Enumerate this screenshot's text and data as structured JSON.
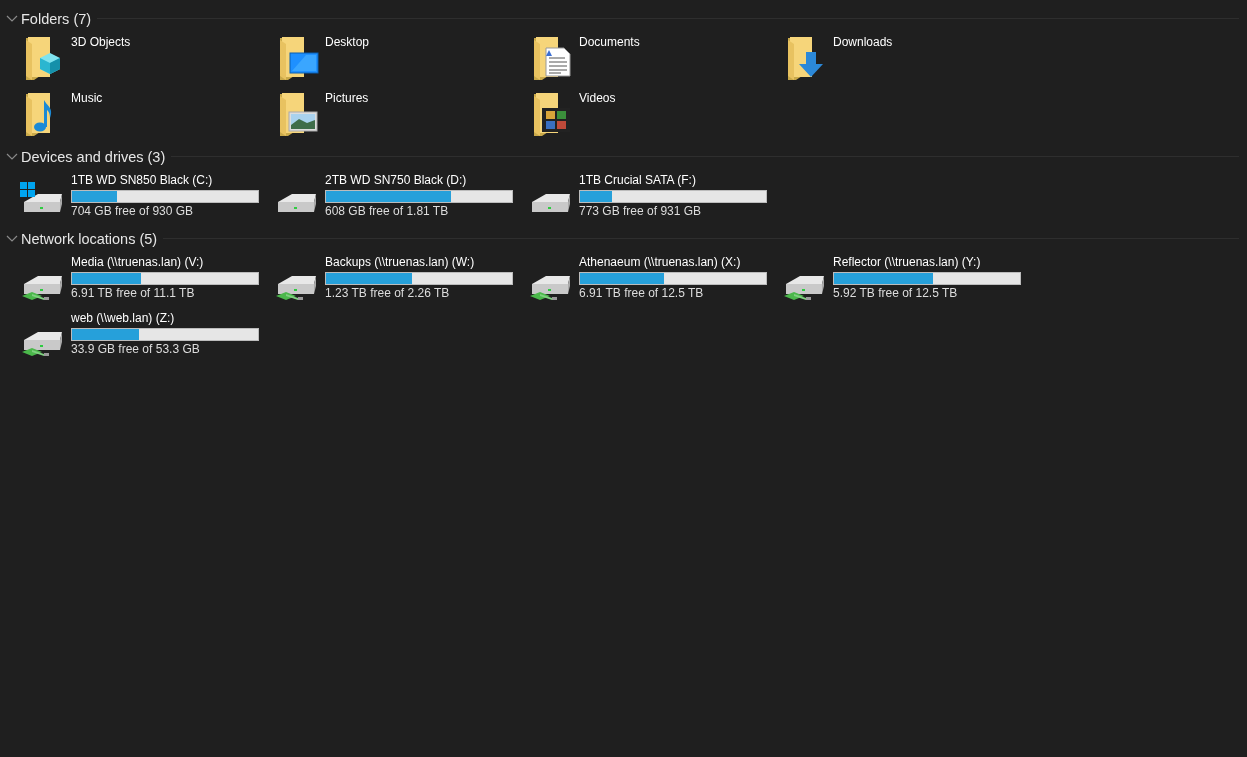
{
  "groups": [
    {
      "kind": "folders",
      "title": "Folders (7)",
      "expanded": true,
      "items": [
        {
          "kind": "objects",
          "name": "3D Objects"
        },
        {
          "kind": "desktop",
          "name": "Desktop"
        },
        {
          "kind": "documents",
          "name": "Documents"
        },
        {
          "kind": "downloads",
          "name": "Downloads"
        },
        {
          "kind": "music",
          "name": "Music"
        },
        {
          "kind": "pictures",
          "name": "Pictures"
        },
        {
          "kind": "videos",
          "name": "Videos"
        }
      ]
    },
    {
      "kind": "drives",
      "title": "Devices and drives (3)",
      "expanded": true,
      "items": [
        {
          "kind": "system",
          "name": "1TB WD SN850 Black (C:)",
          "level": 0.24,
          "free": "704 GB free of 930 GB"
        },
        {
          "kind": "local",
          "name": "2TB WD SN750 Black (D:)",
          "level": 0.67,
          "free": "608 GB free of 1.81 TB"
        },
        {
          "kind": "local",
          "name": "1TB Crucial SATA (F:)",
          "level": 0.17,
          "free": "773 GB free of 931 GB"
        }
      ]
    },
    {
      "kind": "drives",
      "title": "Network locations (5)",
      "expanded": true,
      "items": [
        {
          "kind": "network",
          "name": "Media (\\\\truenas.lan) (V:)",
          "level": 0.37,
          "free": "6.91 TB free of 11.1 TB"
        },
        {
          "kind": "network",
          "name": "Backups (\\\\truenas.lan) (W:)",
          "level": 0.46,
          "free": "1.23 TB free of 2.26 TB"
        },
        {
          "kind": "network",
          "name": "Athenaeum (\\\\truenas.lan) (X:)",
          "level": 0.45,
          "free": "6.91 TB free of 12.5 TB"
        },
        {
          "kind": "network",
          "name": "Reflector (\\\\truenas.lan) (Y:)",
          "level": 0.53,
          "free": "5.92 TB free of 12.5 TB"
        },
        {
          "kind": "network",
          "name": "web (\\\\web.lan) (Z:)",
          "level": 0.36,
          "free": "33.9 GB free of 53.3 GB"
        }
      ]
    }
  ]
}
